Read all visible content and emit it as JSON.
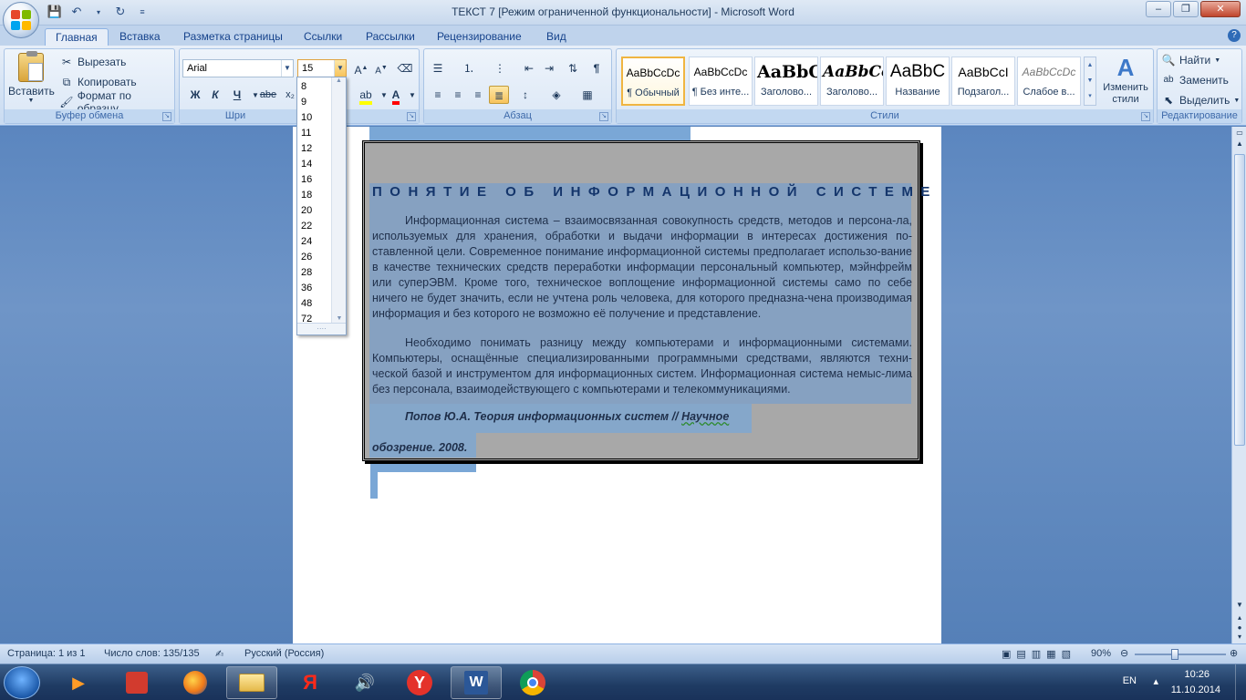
{
  "window": {
    "title": "ТЕКСТ 7 [Режим ограниченной функциональности] - Microsoft Word"
  },
  "tabs": [
    "Главная",
    "Вставка",
    "Разметка страницы",
    "Ссылки",
    "Рассылки",
    "Рецензирование",
    "Вид"
  ],
  "clipboard": {
    "paste": "Вставить",
    "cut": "Вырезать",
    "copy": "Копировать",
    "format_painter": "Формат по образцу",
    "label": "Буфер обмена"
  },
  "font": {
    "name": "Arial",
    "size": "15",
    "label": "Шри",
    "bold": "Ж",
    "italic": "К",
    "underline": "Ч",
    "strike": "abe"
  },
  "paragraph": {
    "label": "Абзац"
  },
  "styles": {
    "label": "Стили",
    "items": [
      {
        "sample": "AaBbCcDc",
        "name": "¶ Обычный"
      },
      {
        "sample": "AaBbCcDc",
        "name": "¶ Без инте..."
      },
      {
        "sample": "AaBbC",
        "name": "Заголово..."
      },
      {
        "sample": "AaBbCc",
        "name": "Заголово..."
      },
      {
        "sample": "AaBbC",
        "name": "Название"
      },
      {
        "sample": "AaBbCcI",
        "name": "Подзагол..."
      },
      {
        "sample": "AaBbCcDc",
        "name": "Слабое в..."
      }
    ],
    "change": "Изменить стили"
  },
  "editing": {
    "find": "Найти",
    "replace": "Заменить",
    "select": "Выделить",
    "label": "Редактирование"
  },
  "size_list": [
    "8",
    "9",
    "10",
    "11",
    "12",
    "14",
    "16",
    "18",
    "20",
    "22",
    "24",
    "26",
    "28",
    "36",
    "48",
    "72"
  ],
  "document": {
    "heading": "ПОНЯТИЕ ОБ ИНФОРМАЦИОННОЙ СИСТЕМЕ",
    "para1": "Информационная система – взаимосвязанная совокупность средств, методов и персона-ла, используемых для хранения, обработки и выдачи информации в интересах достижения по-ставленной цели. Современное понимание информационной системы предполагает использо-вание в качестве технических средств переработки информации персональный компьютер, мэйнфрейм или суперЭВМ. Кроме того, техническое воплощение информационной системы само по себе ничего не будет значить, если не учтена роль человека, для которого предназна-чена производимая информация и без которого не возможно её получение и представление.",
    "para2": "Необходимо понимать разницу между компьютерами и информационными системами. Компьютеры, оснащённые специализированными программными средствами, являются техни-ческой базой и инструментом для информационных систем. Информационная система немыс-лима без персонала, взаимодействующего с компьютерами и телекоммуникациями.",
    "cite_a": "Попов Ю.А. Теория информационных систем // ",
    "cite_b": "Научное",
    "cite_c": "обозрение. 2008."
  },
  "statusbar": {
    "page": "Страница: 1 из 1",
    "words": "Число слов: 135/135",
    "lang": "Русский (Россия)",
    "zoom": "90%"
  },
  "tray": {
    "lang": "EN",
    "time": "10:26",
    "date": "11.10.2014"
  },
  "colors": {
    "office_logo": [
      "#e6462b",
      "#7fba00",
      "#00a4ef",
      "#ffb900"
    ],
    "selection": "#7aa7d6",
    "highlight": "#ffff00",
    "font_color": "#ff0000"
  }
}
